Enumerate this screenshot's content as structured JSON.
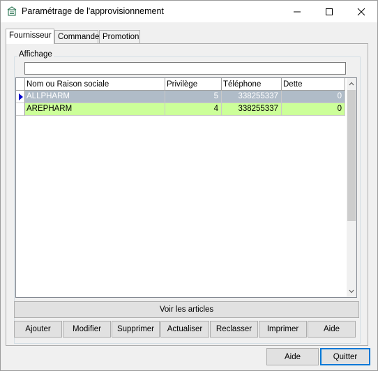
{
  "window": {
    "title": "Paramétrage de l'approvisionnement"
  },
  "tabs": [
    {
      "label": "Fournisseur",
      "active": true
    },
    {
      "label": "Commande",
      "active": false
    },
    {
      "label": "Promotion",
      "active": false
    }
  ],
  "panel": {
    "group_title": "Affichage",
    "filter_value": ""
  },
  "grid": {
    "columns": [
      "Nom ou Raison sociale",
      "Privilège",
      "Téléphone",
      "Dette"
    ],
    "rows": [
      {
        "name": "ALLPHARM",
        "privilege": "5",
        "phone": "338255337",
        "debt": "0",
        "selected": true
      },
      {
        "name": "AREPHARM",
        "privilege": "4",
        "phone": "338255337",
        "debt": "0",
        "selected": false
      }
    ]
  },
  "actions": {
    "view_articles": "Voir les articles",
    "add": "Ajouter",
    "edit": "Modifier",
    "delete": "Supprimer",
    "refresh": "Actualiser",
    "reorder": "Reclasser",
    "print": "Imprimer",
    "help": "Aide"
  },
  "footer": {
    "help": "Aide",
    "quit": "Quitter"
  },
  "colors": {
    "selected_row": "#b0bcc8",
    "highlight_row": "#ccff99",
    "focus_border": "#0078d7"
  }
}
